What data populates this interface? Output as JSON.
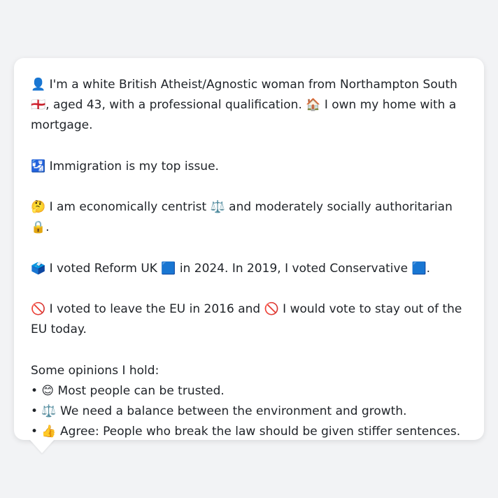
{
  "profile": {
    "line1": "👤 I'm a white British Atheist/Agnostic woman from Northampton South 🏴󠁧󠁢󠁥󠁮󠁧󠁿, aged 43, with a professional qualification. 🏠 I own my home with a mortgage.",
    "line2": "🛂 Immigration is my top issue.",
    "line3": "🤔 I am economically centrist ⚖️ and moderately socially authoritarian 🔒.",
    "line4": "🗳️ I voted Reform UK 🟦 in 2024. In 2019, I voted Conservative 🟦.",
    "line5": "🚫 I voted to leave the EU in 2016 and 🚫 I would vote to stay out of the EU today."
  },
  "opinions": {
    "heading": "Some opinions I hold:",
    "items": [
      "• 😊 Most people can be trusted.",
      "• ⚖️ We need a balance between the environment and growth.",
      "• 👍 Agree: People who break the law should be given stiffer sentences."
    ]
  }
}
